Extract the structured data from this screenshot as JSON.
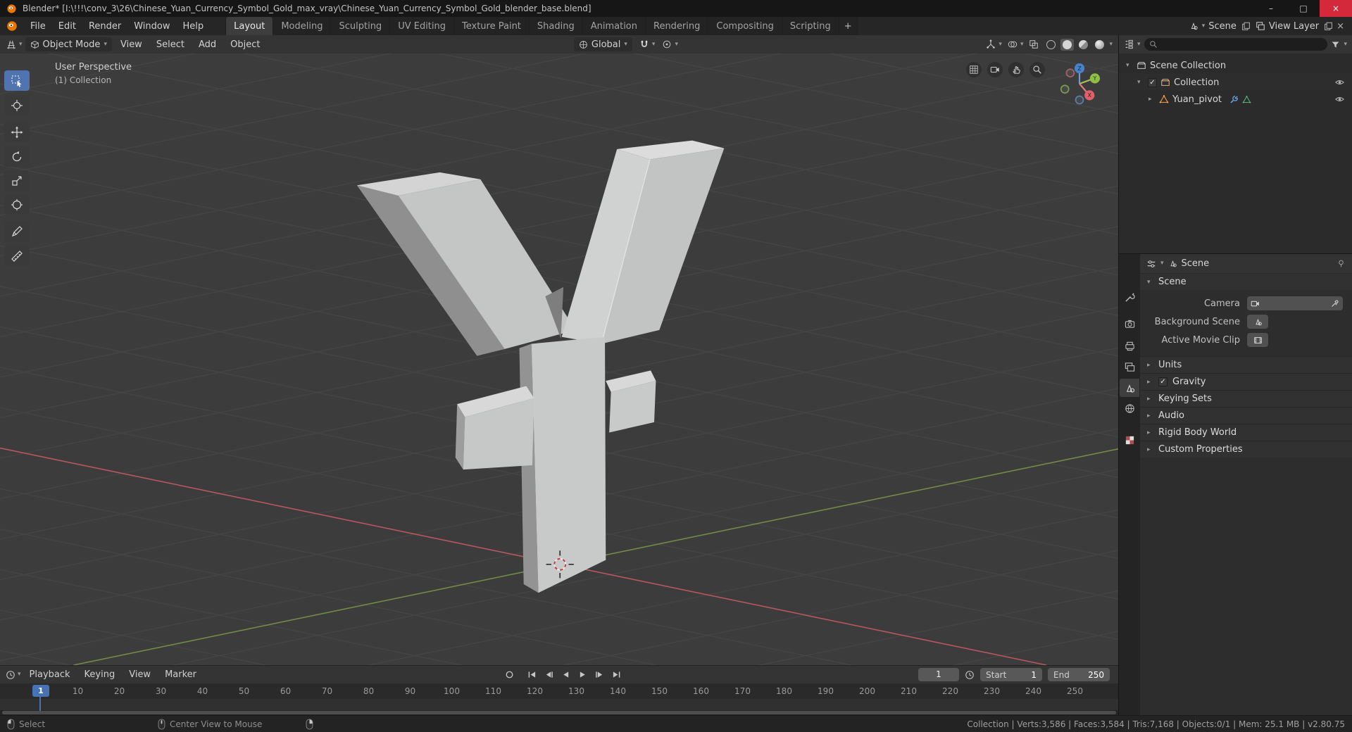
{
  "titlebar": {
    "title": "Blender* [I:\\!!!\\conv_3\\26\\Chinese_Yuan_Currency_Symbol_Gold_max_vray\\Chinese_Yuan_Currency_Symbol_Gold_blender_base.blend]",
    "controls": {
      "minimize": "–",
      "maximize": "□",
      "close": "×"
    }
  },
  "topbar": {
    "menus": [
      "File",
      "Edit",
      "Render",
      "Window",
      "Help"
    ],
    "workspaces": [
      "Layout",
      "Modeling",
      "Sculpting",
      "UV Editing",
      "Texture Paint",
      "Shading",
      "Animation",
      "Rendering",
      "Compositing",
      "Scripting"
    ],
    "active_workspace": "Layout",
    "new_workspace_label": "+",
    "scene": {
      "label": "Scene"
    },
    "view_layer": {
      "label": "View Layer"
    }
  },
  "viewport": {
    "header": {
      "mode": "Object Mode",
      "menus": [
        "View",
        "Select",
        "Add",
        "Object"
      ],
      "orientation": "Global"
    },
    "overlay": {
      "line1": "User Perspective",
      "line2": "(1) Collection"
    },
    "gizmo": {
      "x": "X",
      "y": "Y",
      "z": "Z"
    }
  },
  "outliner": {
    "rows": [
      {
        "label": "Scene Collection"
      },
      {
        "label": "Collection"
      },
      {
        "label": "Yuan_pivot"
      }
    ]
  },
  "properties": {
    "breadcrumb": "Scene",
    "scene_panel": {
      "title": "Scene",
      "fields": [
        {
          "label": "Camera"
        },
        {
          "label": "Background Scene"
        },
        {
          "label": "Active Movie Clip"
        }
      ]
    },
    "panels": [
      {
        "label": "Units"
      },
      {
        "label": "Gravity"
      },
      {
        "label": "Keying Sets"
      },
      {
        "label": "Audio"
      },
      {
        "label": "Rigid Body World"
      },
      {
        "label": "Custom Properties"
      }
    ]
  },
  "timeline": {
    "menus": [
      "Playback",
      "Keying",
      "View",
      "Marker"
    ],
    "current_frame": "1",
    "frame_field": "1",
    "start_label": "Start",
    "start_value": "1",
    "end_label": "End",
    "end_value": "250",
    "ticks": [
      "10",
      "20",
      "30",
      "40",
      "50",
      "60",
      "70",
      "80",
      "90",
      "100",
      "110",
      "120",
      "130",
      "140",
      "150",
      "160",
      "170",
      "180",
      "190",
      "200",
      "210",
      "220",
      "230",
      "240",
      "250"
    ]
  },
  "statusbar": {
    "left_hint": "Select",
    "middle_hint": "Center View to Mouse",
    "stats": "Collection | Verts:3,586 | Faces:3,584 | Tris:7,168 | Objects:0/1 | Mem: 25.1 MB | v2.80.75"
  },
  "colors": {
    "accent": "#4772b3",
    "axis_x": "#cb5b64",
    "axis_y": "#7d9946",
    "mesh_icon": "#ff9e4a"
  },
  "icons": {
    "chevron_down": "▾",
    "collapsed_arrow": "▸",
    "expanded_arrow": "▾",
    "check": "✓",
    "search": "magnifier",
    "filter": "funnel",
    "visibility": "eye"
  }
}
